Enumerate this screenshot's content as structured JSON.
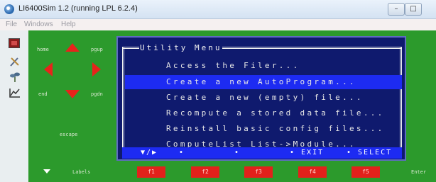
{
  "window": {
    "title": "LI6400Sim 1.2 (running LPL 6.2.4)",
    "minimize_glyph": "–",
    "maximize_glyph": "□"
  },
  "menubar": {
    "items": [
      "File",
      "Windows",
      "Help"
    ]
  },
  "keypad": {
    "home": "home",
    "pgup": "pgup",
    "end": "end",
    "pgdn": "pgdn",
    "escape": "escape",
    "labels": "Labels",
    "enter": "Enter"
  },
  "function_keys": [
    "f1",
    "f2",
    "f3",
    "f4",
    "f5"
  ],
  "utility_menu": {
    "title": "Utility Menu",
    "items": [
      "Access the Filer...",
      "Create a new AutoProgram...",
      "Create a new (empty) file...",
      "Recompute a stored data file...",
      "Reinstall basic config files...",
      "ComputeList List->Module..."
    ],
    "selected_index": 1,
    "footer": {
      "nav": "▼/▶",
      "dot1": "•",
      "dot2": "•",
      "exit": "• EXIT",
      "select": "• SELECT"
    }
  },
  "colors": {
    "screen_green": "#2c9a2c",
    "key_red": "#e2211b",
    "panel_navy": "#0f1a6e",
    "highlight_blue": "#1d2bf2"
  },
  "icons": [
    "app-icon",
    "record-icon",
    "tools-icon",
    "plant-icon",
    "chart-icon"
  ]
}
